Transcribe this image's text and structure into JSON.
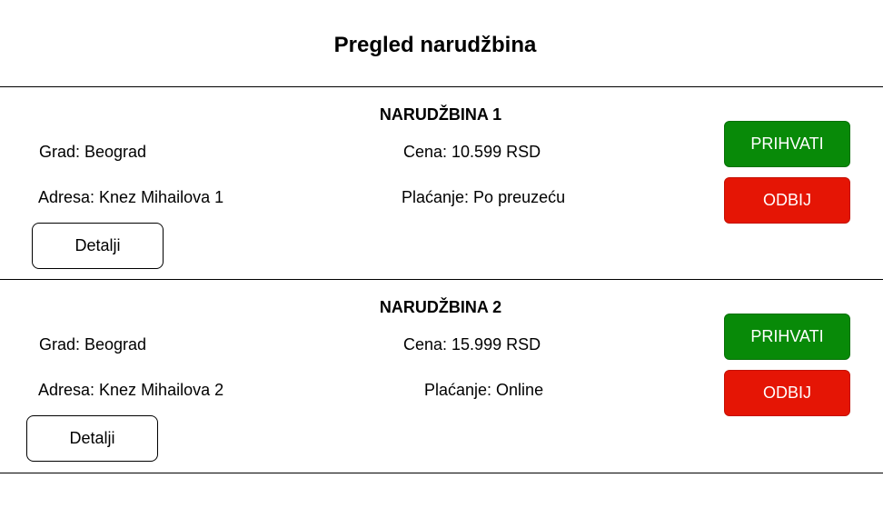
{
  "header": {
    "title": "Pregled narudžbina"
  },
  "orders": [
    {
      "title": "NARUDŽBINA 1",
      "city": "Grad: Beograd",
      "address": "Adresa: Knez Mihailova 1",
      "price": "Cena: 10.599 RSD",
      "payment": "Plaćanje: Po preuzeću",
      "accept_label": "PRIHVATI",
      "reject_label": "ODBIJ",
      "details_label": "Detalji"
    },
    {
      "title": "NARUDŽBINA 2",
      "city": "Grad: Beograd",
      "address": "Adresa: Knez Mihailova 2",
      "price": "Cena: 15.999 RSD",
      "payment": "Plaćanje: Online",
      "accept_label": "PRIHVATI",
      "reject_label": "ODBIJ",
      "details_label": "Detalji"
    }
  ],
  "colors": {
    "accept": "#088a08",
    "reject": "#e51505"
  }
}
